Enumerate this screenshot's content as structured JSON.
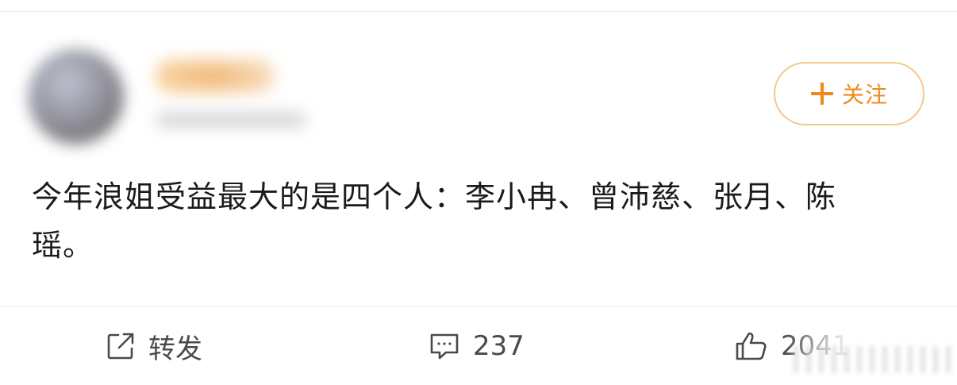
{
  "post": {
    "text": "今年浪姐受益最大的是四个人：李小冉、曾沛慈、张月、陈瑶。"
  },
  "follow": {
    "icon": "plus-icon",
    "label": "关注"
  },
  "actions": {
    "repost": {
      "icon": "share-icon",
      "label": "转发"
    },
    "comment": {
      "icon": "comment-icon",
      "count": "237"
    },
    "like": {
      "icon": "thumbs-up-icon",
      "count": "2041"
    }
  },
  "colors": {
    "accent": "#ee8a1d",
    "follow_border": "#f3c88a",
    "text": "#1a1a1a",
    "action_text": "#4a4a4a",
    "divider": "#ececec"
  }
}
